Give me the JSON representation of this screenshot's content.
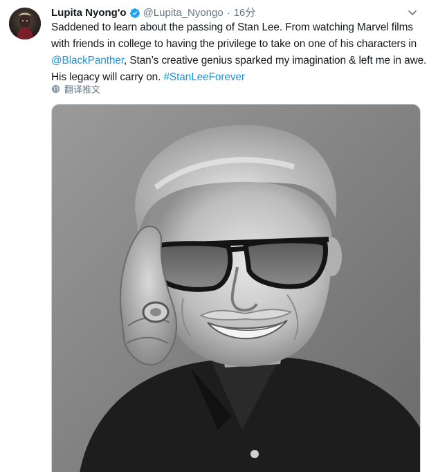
{
  "tweet": {
    "author": {
      "display_name": "Lupita Nyong'o",
      "verified": true,
      "handle": "@Lupita_Nyongo",
      "separator": "·",
      "time": "16分"
    },
    "text": {
      "part1": "Saddened to learn about the passing of Stan Lee. From watching Marvel films",
      "part2": "with friends in college to having the privilege to take on one of his characters in",
      "mention": "@BlackPanther",
      "part3": ", Stan’s creative genius sparked my imagination & left me in awe.",
      "part4": "His legacy will carry on. ",
      "hashtag": "#StanLeeForever"
    },
    "translate_label": "翻译推文",
    "icons": {
      "verified": "verified-badge-icon",
      "more": "chevron-down-icon",
      "translate": "globe-icon"
    },
    "colors": {
      "link": "#1b95e0",
      "verified": "#1da1f2",
      "muted": "#657786"
    }
  }
}
